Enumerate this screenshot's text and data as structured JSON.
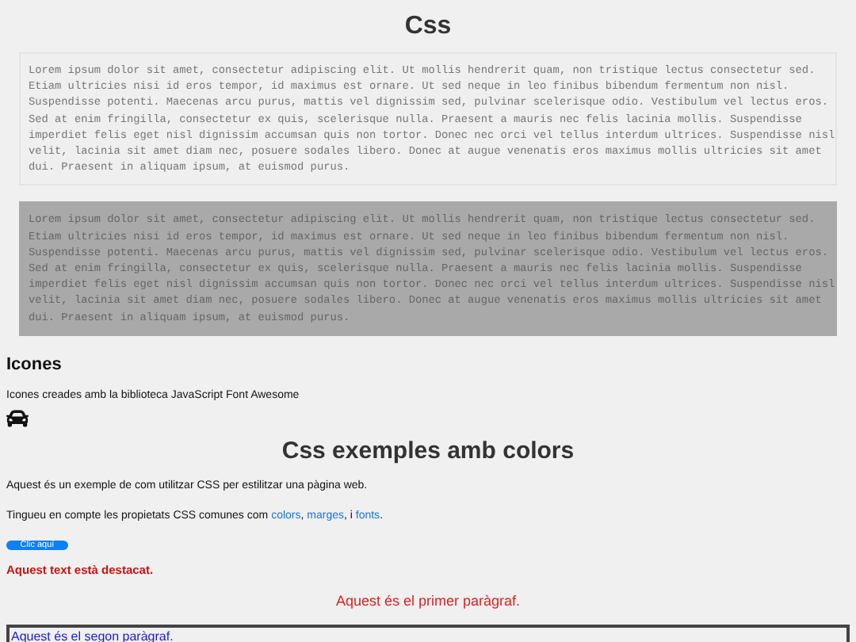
{
  "title": "Css",
  "code_blocks": [
    {
      "dark": false,
      "lines": [
        "Lorem ipsum dolor sit amet, consectetur adipiscing elit. Ut mollis hendrerit quam, non tristique lectus consectetur sed.",
        "Etiam ultricies nisi id eros tempor, id maximus est ornare. Ut sed neque in leo finibus bibendum fermentum non nisl.",
        "Suspendisse potenti. Maecenas arcu purus, mattis vel dignissim sed, pulvinar scelerisque odio. Vestibulum vel lectus eros.",
        "Sed at enim fringilla, consectetur ex quis, scelerisque nulla. Praesent a mauris nec felis lacinia mollis. Suspendisse",
        "imperdiet felis eget nisl dignissim accumsan quis non tortor. Donec nec orci vel tellus interdum ultrices. Suspendisse nisl",
        "velit, lacinia sit amet diam nec, posuere sodales libero. Donec at augue venenatis eros maximus mollis ultricies sit amet",
        "dui. Praesent in aliquam ipsum, at euismod purus."
      ]
    },
    {
      "dark": true,
      "lines": [
        "Lorem ipsum dolor sit amet, consectetur adipiscing elit. Ut mollis hendrerit quam, non tristique lectus consectetur sed.",
        "Etiam ultricies nisi id eros tempor, id maximus est ornare. Ut sed neque in leo finibus bibendum fermentum non nisl.",
        "Suspendisse potenti. Maecenas arcu purus, mattis vel dignissim sed, pulvinar scelerisque odio. Vestibulum vel lectus eros.",
        "Sed at enim fringilla, consectetur ex quis, scelerisque nulla. Praesent a mauris nec felis lacinia mollis. Suspendisse",
        "imperdiet felis eget nisl dignissim accumsan quis non tortor. Donec nec orci vel tellus interdum ultrices. Suspendisse nisl",
        "velit, lacinia sit amet diam nec, posuere sodales libero. Donec at augue venenatis eros maximus mollis ultricies sit amet",
        "dui. Praesent in aliquam ipsum, at euismod purus."
      ]
    }
  ],
  "icons_section": {
    "heading": "Icones",
    "text": "Icones creades amb la biblioteca JavaScript Font Awesome"
  },
  "colors_section": {
    "heading": "Css exemples amb colors",
    "intro": "Aquest és un exemple de com utilitzar CSS per estilitzar una pàgina web.",
    "properties": {
      "text": "Tingueu en compte les propietats CSS comunes com",
      "links": [
        "colors",
        "marges",
        "fonts"
      ],
      "separators": [
        ", ",
        ", i "
      ],
      "end": "."
    },
    "button": "Clic aquí",
    "highlight": "Aquest text està destacat.",
    "first_paragraph": "Aquest és el primer paràgraf.",
    "second_paragraph": "Aquest és el segon paràgraf."
  }
}
